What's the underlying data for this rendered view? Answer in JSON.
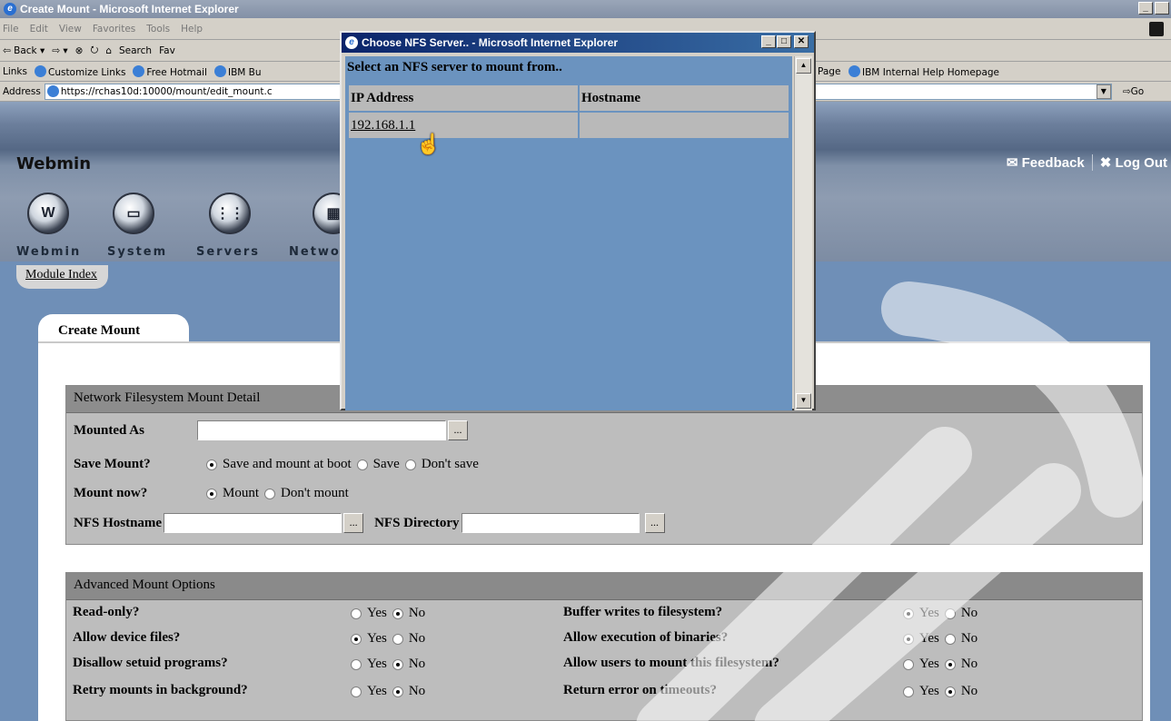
{
  "main_window": {
    "title": "Create Mount - Microsoft Internet Explorer",
    "title_btns": [
      "_",
      " "
    ],
    "menu": [
      "File",
      "Edit",
      "View",
      "Favorites",
      "Tools",
      "Help"
    ],
    "toolbar": [
      "⇦ Back ▾",
      "⇨ ▾",
      "⊗",
      "⭮",
      "⌂",
      "Search",
      "Fav"
    ],
    "links_label": "Links",
    "links": [
      "Customize Links",
      "Free Hotmail",
      "IBM Bu"
    ],
    "links_right": [
      "Page",
      "IBM Internal Help Homepage"
    ],
    "address_label": "Address",
    "address_value": "https://rchas10d:10000/mount/edit_mount.c",
    "go_label": "Go"
  },
  "webmin": {
    "logo": "Webmin",
    "feedback": "Feedback",
    "logout": "Log Out",
    "modules": [
      "Webmin",
      "System",
      "Servers",
      "Netwo"
    ],
    "module_index": "Module Index"
  },
  "page": {
    "tab_title": "Create Mount",
    "nfs_section": {
      "header": "Network Filesystem Mount Detail",
      "mounted_as_label": "Mounted As",
      "mounted_as_value": "",
      "save_mount_label": "Save Mount?",
      "save_options": [
        "Save and mount at boot",
        "Save",
        "Don't save"
      ],
      "save_selected": 0,
      "mount_now_label": "Mount now?",
      "mount_options": [
        "Mount",
        "Don't mount"
      ],
      "mount_selected": 0,
      "nfs_hostname_label": "NFS Hostname",
      "nfs_hostname_value": "",
      "nfs_directory_label": "NFS Directory",
      "nfs_directory_value": "",
      "browse": "..."
    },
    "advanced": {
      "header": "Advanced Mount Options",
      "yes": "Yes",
      "no": "No",
      "left": [
        {
          "label": "Read-only?",
          "selected": "no"
        },
        {
          "label": "Allow device files?",
          "selected": "yes"
        },
        {
          "label": "Disallow setuid programs?",
          "selected": "no"
        },
        {
          "label": "Retry mounts in background?",
          "selected": "no"
        }
      ],
      "right": [
        {
          "label": "Buffer writes to filesystem?",
          "selected": "yes"
        },
        {
          "label": "Allow execution of binaries?",
          "selected": "yes"
        },
        {
          "label": "Allow users to mount this filesystem?",
          "selected": "no"
        },
        {
          "label": "Return error on timeouts?",
          "selected": "no"
        }
      ]
    }
  },
  "popup": {
    "title": "Choose NFS Server.. - Microsoft Internet Explorer",
    "heading": "Select an NFS server to mount from..",
    "columns": [
      "IP Address",
      "Hostname"
    ],
    "rows": [
      {
        "ip": "192.168.1.1",
        "hostname": ""
      }
    ]
  }
}
